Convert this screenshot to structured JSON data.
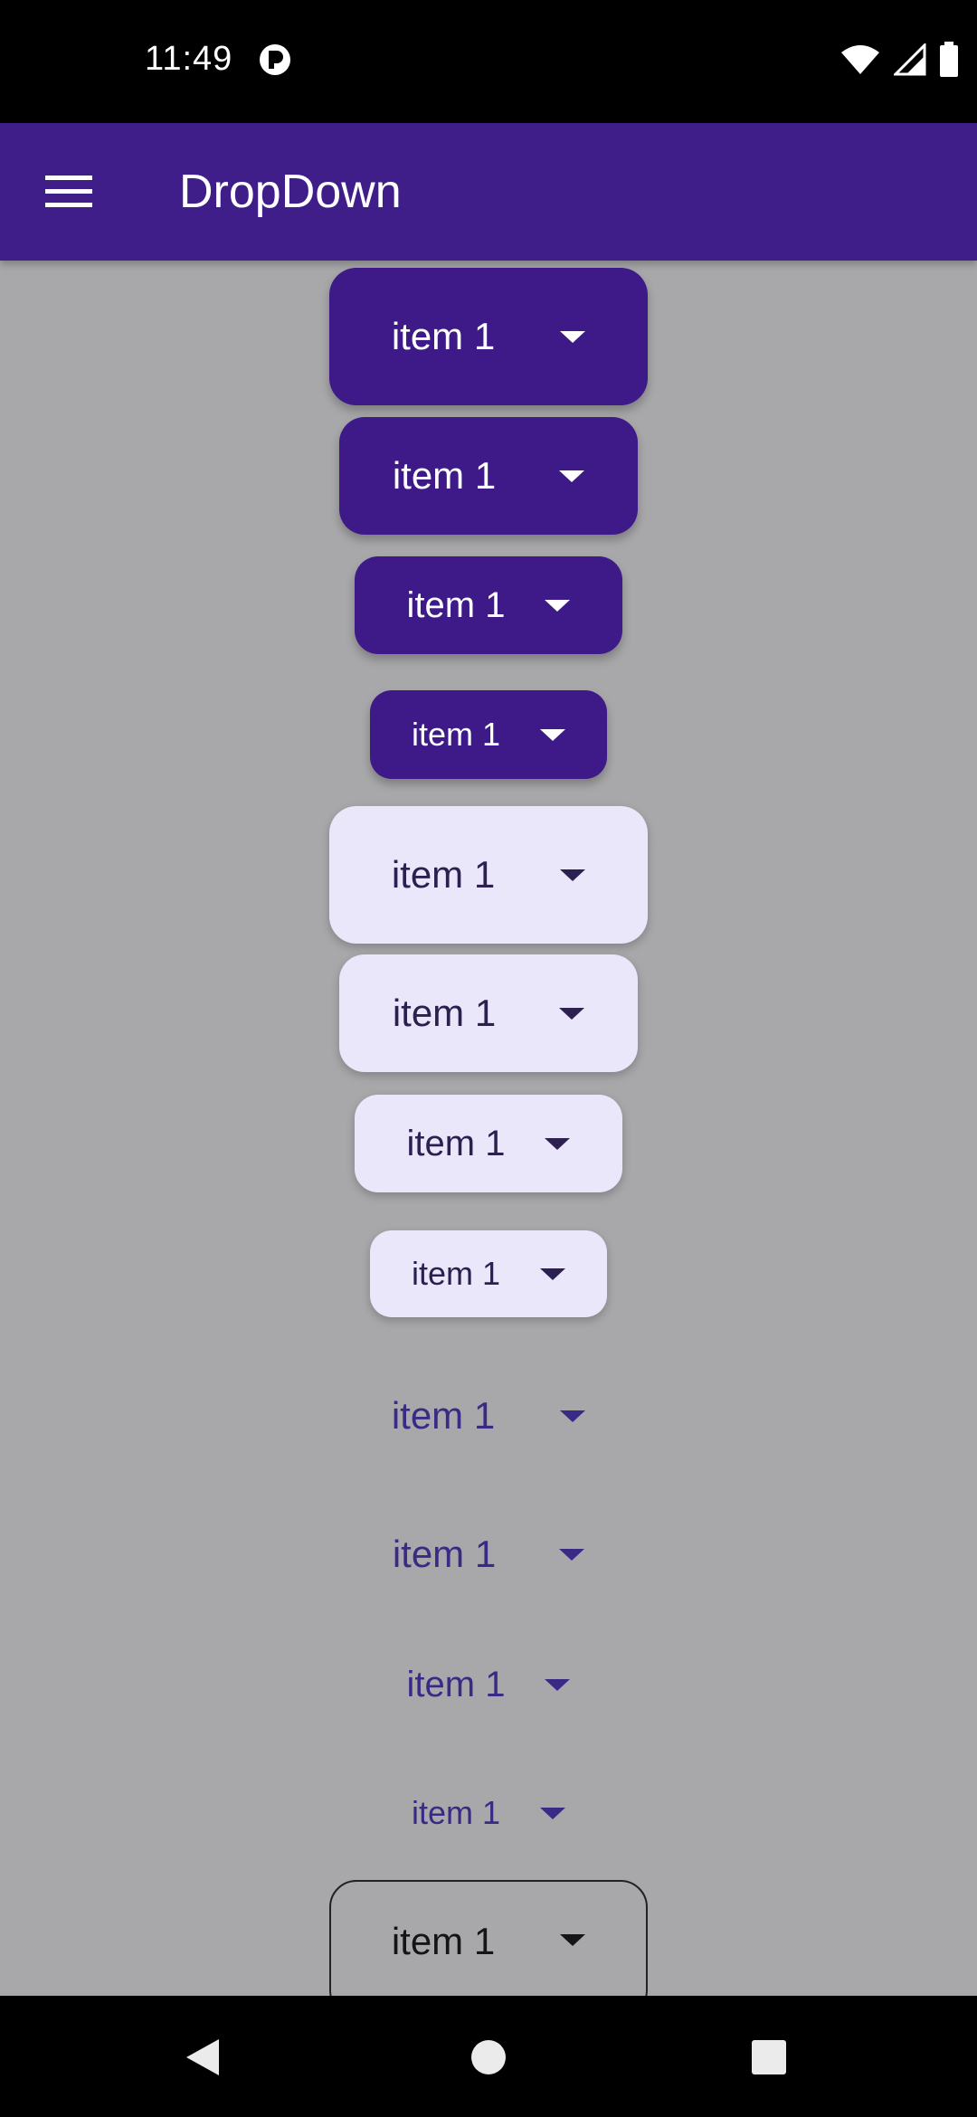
{
  "status_bar": {
    "time": "11:49",
    "icons": [
      "app-notification-icon",
      "wifi-icon",
      "signal-icon",
      "battery-icon"
    ]
  },
  "app_bar": {
    "title": "DropDown",
    "menu_icon": "hamburger-menu-icon",
    "color": "#3f1e8a"
  },
  "dropdowns": [
    {
      "label": "item 1",
      "style": "filled"
    },
    {
      "label": "item 1",
      "style": "filled"
    },
    {
      "label": "item 1",
      "style": "filled"
    },
    {
      "label": "item 1",
      "style": "filled"
    },
    {
      "label": "item 1",
      "style": "tonal"
    },
    {
      "label": "item 1",
      "style": "tonal"
    },
    {
      "label": "item 1",
      "style": "tonal"
    },
    {
      "label": "item 1",
      "style": "tonal"
    },
    {
      "label": "item 1",
      "style": "text"
    },
    {
      "label": "item 1",
      "style": "text"
    },
    {
      "label": "item 1",
      "style": "text"
    },
    {
      "label": "item 1",
      "style": "text"
    },
    {
      "label": "item 1",
      "style": "outlined"
    }
  ],
  "nav_bar": {
    "icons": [
      "back-icon",
      "home-icon",
      "recents-icon"
    ]
  },
  "colors": {
    "background": "#a8a8aa",
    "filled": "#3d1a88",
    "tonal": "#ebe7fb",
    "text": "#3b2a85"
  }
}
